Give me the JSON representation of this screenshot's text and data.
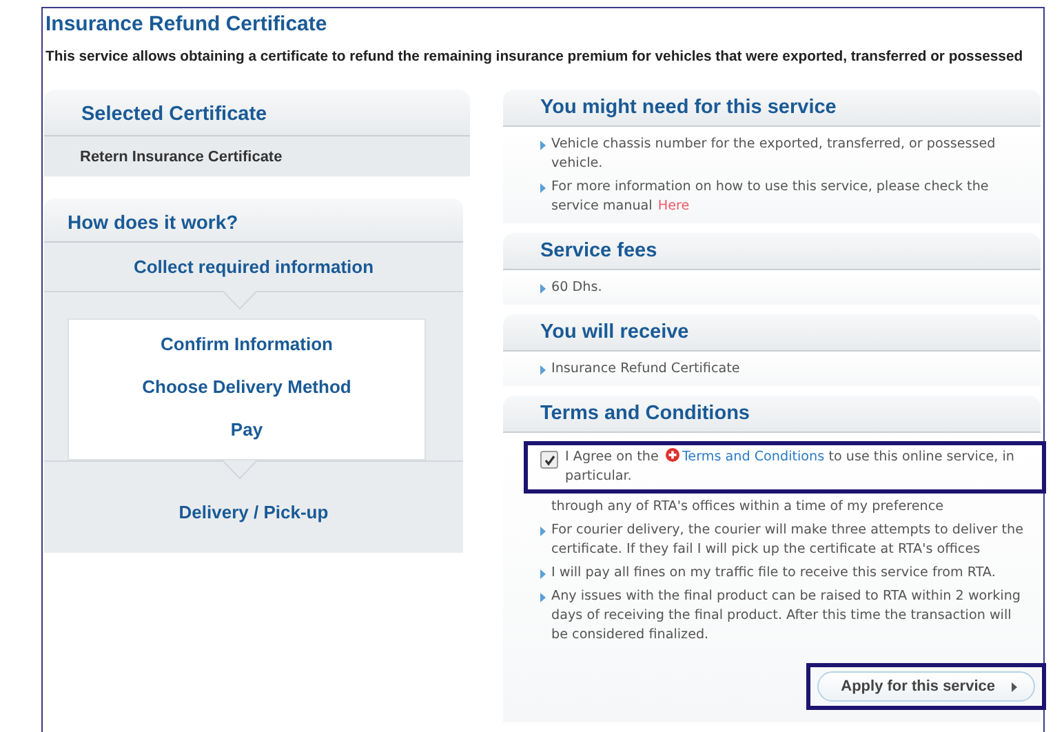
{
  "title": "Insurance Refund Certificate",
  "description": "This service allows obtaining a certificate to refund the remaining insurance premium for vehicles that were exported, transferred or possessed",
  "selected_certificate": {
    "heading": "Selected Certificate",
    "value": "Retern Insurance Certificate"
  },
  "how_it_works": {
    "heading": "How does it work?",
    "steps": [
      {
        "kind": "stage",
        "label": "Collect required information"
      },
      {
        "kind": "group",
        "items": [
          "Confirm Information",
          "Choose Delivery Method",
          "Pay"
        ]
      },
      {
        "kind": "stage",
        "label": "Delivery / Pick-up"
      }
    ]
  },
  "sections": [
    {
      "heading": "You might need for this service",
      "items": [
        {
          "text": "Vehicle chassis number for the exported, transferred, or possessed vehicle."
        },
        {
          "text": "For more information on how to use this service, please check the service manual",
          "link": "Here"
        }
      ]
    },
    {
      "heading": "Service fees",
      "items": [
        {
          "text": "60 Dhs."
        }
      ]
    },
    {
      "heading": "You will receive",
      "items": [
        {
          "text": "Insurance Refund Certificate"
        }
      ]
    }
  ],
  "terms": {
    "heading": "Terms and Conditions",
    "agree": {
      "checked": true,
      "before": "I Agree on the",
      "link": "Terms and Conditions",
      "after": "to use this online service, in particular."
    },
    "items": [
      {
        "kind": "continued",
        "text": "through any of RTA's offices within a time of my preference"
      },
      {
        "kind": "bullet",
        "text": "For courier delivery, the courier will make three attempts to deliver the certificate. If they fail I will pick up the certificate at RTA's offices"
      },
      {
        "kind": "bullet",
        "text": "I will pay all fines on my traffic file to receive this service from RTA."
      },
      {
        "kind": "bullet",
        "text": "Any issues with the final product can be raised to RTA within 2 working days of receiving the final product. After this time the transaction will be considered finalized."
      }
    ],
    "apply_button": "Apply for this service"
  }
}
